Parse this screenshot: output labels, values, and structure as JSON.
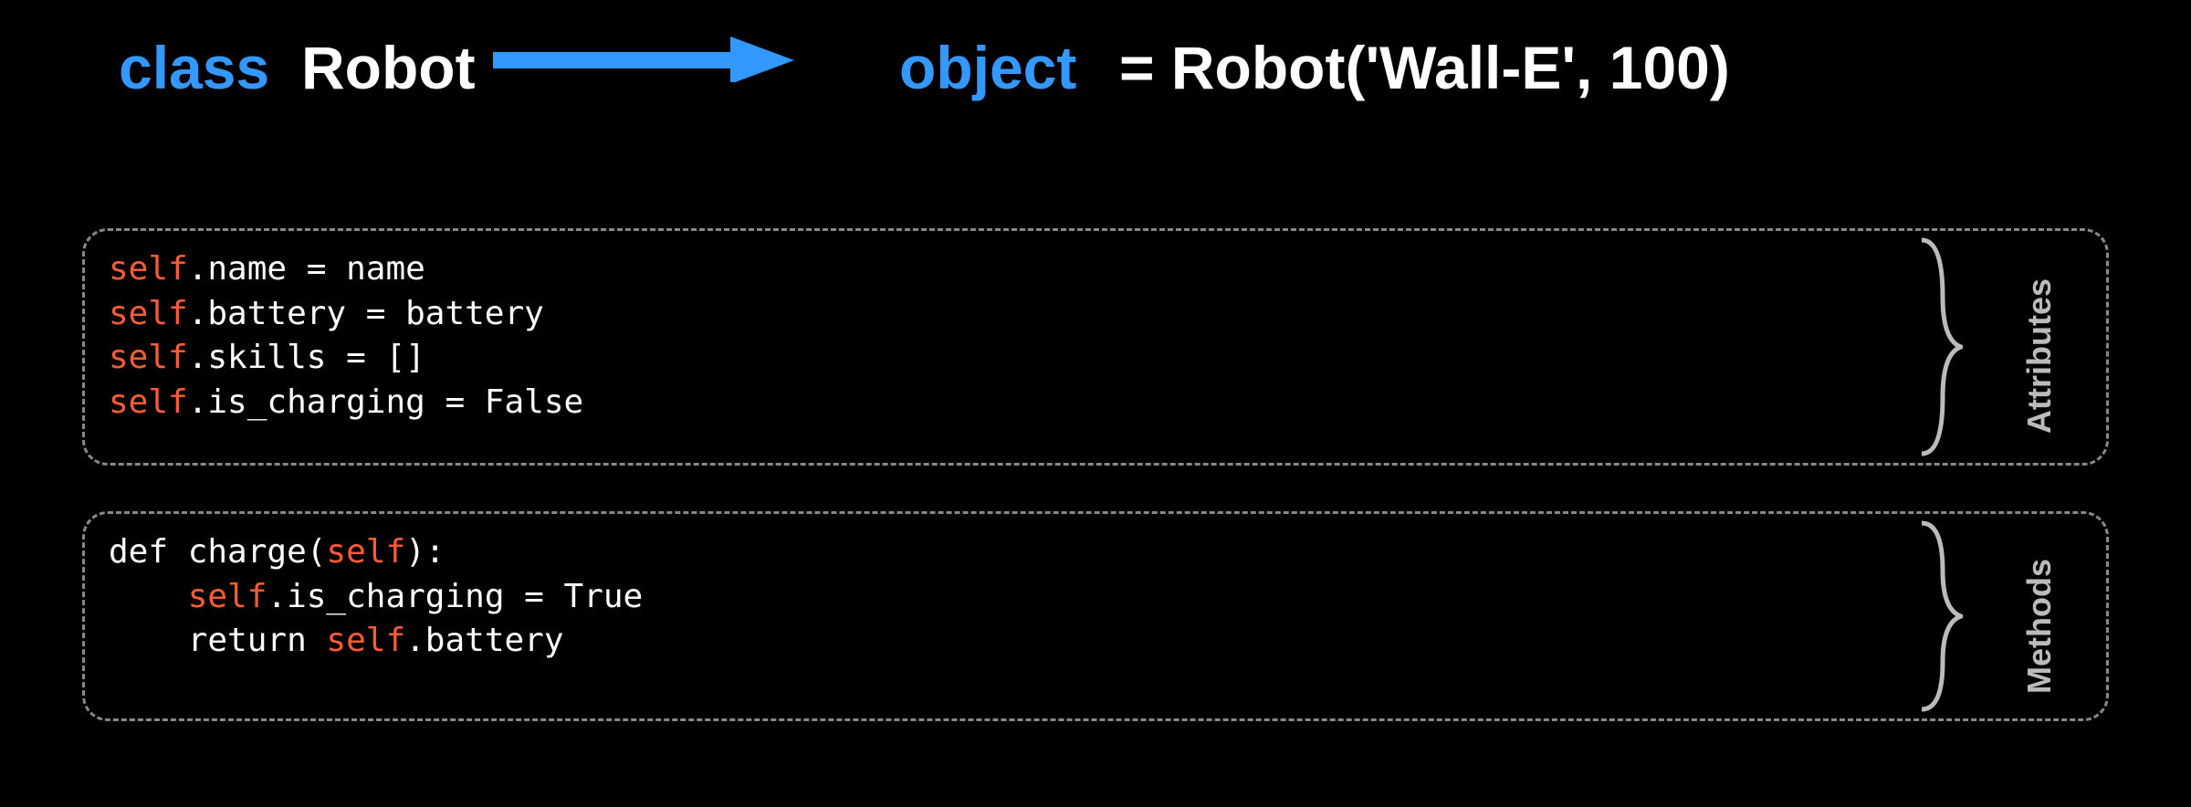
{
  "colors": {
    "accent": "#3398ff",
    "self_keyword": "#ff5c33",
    "brace": "#bbbbbb",
    "box_border": "#888888"
  },
  "header": {
    "class_keyword": "class",
    "class_name": "Robot",
    "object_keyword": "object",
    "object_name": "= Robot('Wall-E', 100)"
  },
  "attributes_box": {
    "label": "Attributes",
    "lines": [
      {
        "pre": "",
        "kw": "self",
        "post": ".name = name"
      },
      {
        "pre": "",
        "kw": "self",
        "post": ".battery = battery"
      },
      {
        "pre": "",
        "kw": "self",
        "post": ".skills = []"
      },
      {
        "pre": "",
        "kw": "self",
        "post": ".is_charging = False"
      }
    ]
  },
  "methods_box": {
    "label": "Methods",
    "lines": [
      {
        "pre": "def charge(",
        "kw": "self",
        "post": "):"
      },
      {
        "pre": "    ",
        "kw": "self",
        "post": ".is_charging = True"
      },
      {
        "pre": "    return ",
        "kw": "self",
        "post": ".battery"
      }
    ]
  }
}
